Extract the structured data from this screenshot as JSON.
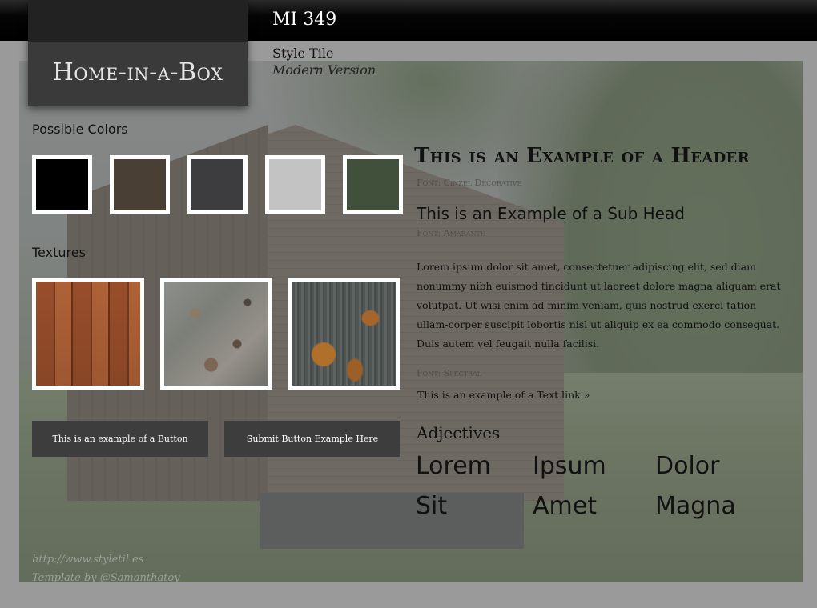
{
  "header": {
    "course": "MI 349",
    "logo": "Home-in-a-Box",
    "tile_label": "Style Tile",
    "tile_version": "Modern Version"
  },
  "colors": {
    "label": "Possible Colors",
    "swatches": [
      "#000000",
      "#4a3f34",
      "#3d3d3f",
      "#c3c3c3",
      "#41503b"
    ]
  },
  "textures": {
    "label": "Textures",
    "items": [
      "wood-planks",
      "weathered-stone",
      "rusted-metal"
    ]
  },
  "buttons": {
    "example": "This is an example of a Button",
    "submit": "Submit Button Example Here"
  },
  "typography": {
    "header": "This is an Example of a Header",
    "header_font": "Font: Cinzel Decorative",
    "subhead": "This is an Example of a Sub Head",
    "subhead_font": "Font: Amaranth",
    "body": "Lorem ipsum dolor sit amet, consectetuer adipiscing elit, sed diam nonummy nibh euismod tincidunt ut laoreet dolore magna aliquam erat volutpat. Ut wisi enim ad minim veniam, quis nostrud exerci tation ullam-corper suscipit lobortis nisl ut aliquip ex ea commodo consequat. Duis autem vel feugait nulla facilisi.",
    "body_font": "Font: Spectral",
    "link": "This is an example of a Text link »"
  },
  "adjectives": {
    "label": "Adjectives",
    "words": [
      "Lorem",
      "Ipsum",
      "Dolor",
      "Sit",
      "Amet",
      "Magna"
    ]
  },
  "credits": {
    "url": "http://www.styletil.es",
    "template": "Template by @Samanthatoy"
  }
}
